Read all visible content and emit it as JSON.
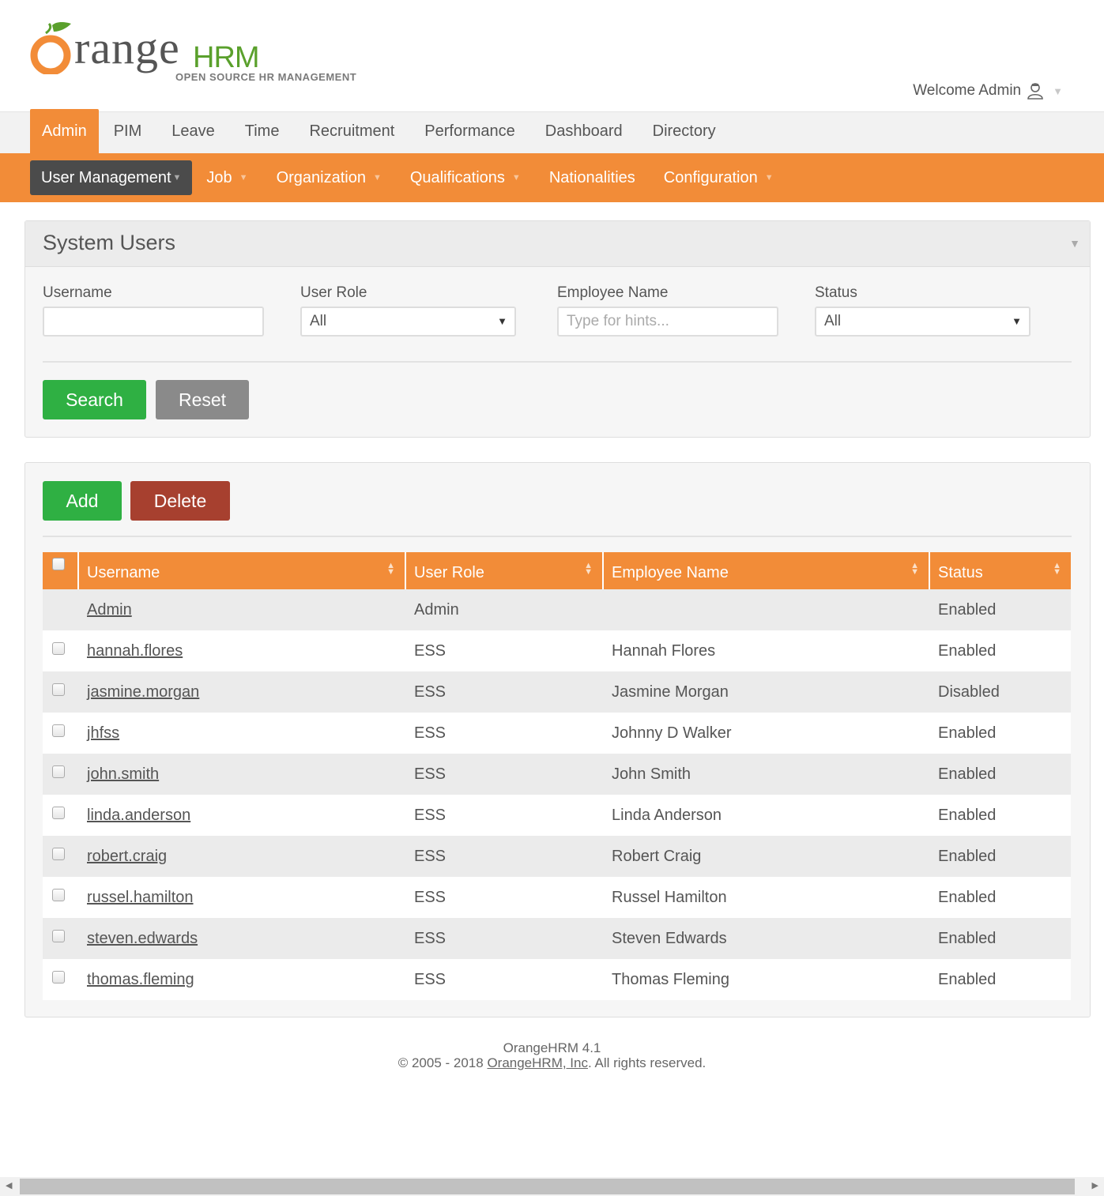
{
  "brand": {
    "logo_main": "range",
    "logo_suffix": "HRM",
    "tagline": "OPEN SOURCE HR MANAGEMENT",
    "orange_color": "#f28c38",
    "green_color": "#5aa02c"
  },
  "header": {
    "welcome_text": "Welcome Admin",
    "user_icon": "user-icon"
  },
  "topnav": {
    "items": [
      {
        "label": "Admin",
        "active": true
      },
      {
        "label": "PIM"
      },
      {
        "label": "Leave"
      },
      {
        "label": "Time"
      },
      {
        "label": "Recruitment"
      },
      {
        "label": "Performance"
      },
      {
        "label": "Dashboard"
      },
      {
        "label": "Directory"
      }
    ]
  },
  "subnav": {
    "items": [
      {
        "label": "User Management",
        "active": true,
        "dropdown": true
      },
      {
        "label": "Job",
        "dropdown": true
      },
      {
        "label": "Organization",
        "dropdown": true
      },
      {
        "label": "Qualifications",
        "dropdown": true
      },
      {
        "label": "Nationalities",
        "dropdown": false
      },
      {
        "label": "Configuration",
        "dropdown": true
      }
    ]
  },
  "search_panel": {
    "title": "System Users",
    "fields": {
      "username_label": "Username",
      "username_value": "",
      "role_label": "User Role",
      "role_value": "All",
      "employee_label": "Employee Name",
      "employee_placeholder": "Type for hints...",
      "status_label": "Status",
      "status_value": "All"
    },
    "search_button": "Search",
    "reset_button": "Reset"
  },
  "list_panel": {
    "add_button": "Add",
    "delete_button": "Delete",
    "columns": [
      "Username",
      "User Role",
      "Employee Name",
      "Status"
    ],
    "rows": [
      {
        "username": "Admin",
        "role": "Admin",
        "employee": "",
        "status": "Enabled",
        "checkbox": false
      },
      {
        "username": "hannah.flores",
        "role": "ESS",
        "employee": "Hannah Flores",
        "status": "Enabled",
        "checkbox": true
      },
      {
        "username": "jasmine.morgan",
        "role": "ESS",
        "employee": "Jasmine Morgan",
        "status": "Disabled",
        "checkbox": true
      },
      {
        "username": "jhfss",
        "role": "ESS",
        "employee": "Johnny D Walker",
        "status": "Enabled",
        "checkbox": true
      },
      {
        "username": "john.smith",
        "role": "ESS",
        "employee": "John Smith",
        "status": "Enabled",
        "checkbox": true
      },
      {
        "username": "linda.anderson",
        "role": "ESS",
        "employee": "Linda Anderson",
        "status": "Enabled",
        "checkbox": true
      },
      {
        "username": "robert.craig",
        "role": "ESS",
        "employee": "Robert Craig",
        "status": "Enabled",
        "checkbox": true
      },
      {
        "username": "russel.hamilton",
        "role": "ESS",
        "employee": "Russel Hamilton",
        "status": "Enabled",
        "checkbox": true
      },
      {
        "username": "steven.edwards",
        "role": "ESS",
        "employee": "Steven Edwards",
        "status": "Enabled",
        "checkbox": true
      },
      {
        "username": "thomas.fleming",
        "role": "ESS",
        "employee": "Thomas Fleming",
        "status": "Enabled",
        "checkbox": true
      }
    ]
  },
  "footer": {
    "version": "OrangeHRM 4.1",
    "copyright_prefix": "© 2005 - 2018 ",
    "company_link": "OrangeHRM, Inc",
    "copyright_suffix": ". All rights reserved."
  }
}
